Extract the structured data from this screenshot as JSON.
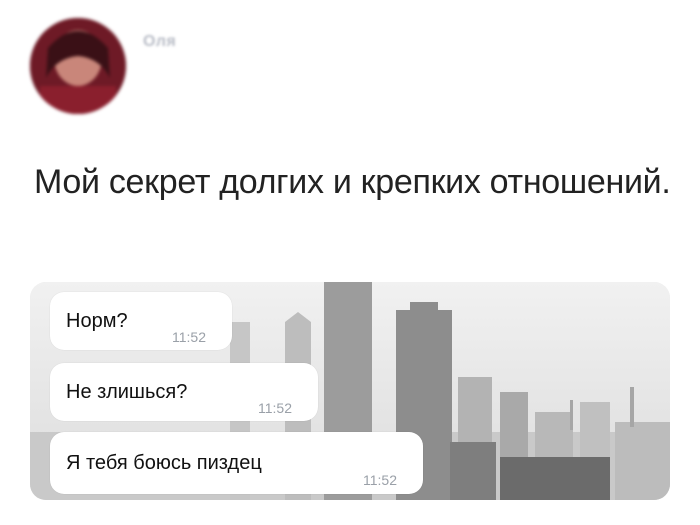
{
  "post": {
    "author_name": "Оля",
    "caption": "Мой секрет долгих и крепких отношений."
  },
  "chat": {
    "messages": [
      {
        "text": "Норм?",
        "time": "11:52"
      },
      {
        "text": "Не злишься?",
        "time": "11:52"
      },
      {
        "text": "Я тебя боюсь пиздец",
        "time": "11:52"
      }
    ]
  },
  "colors": {
    "bubble": "#ffffff",
    "time": "#9aa0a8",
    "caption": "#222222",
    "avatar": "#7a1c2a"
  }
}
